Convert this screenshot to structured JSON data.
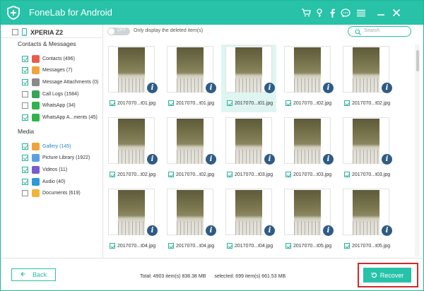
{
  "app": {
    "title": "FoneLab for Android",
    "accent_color": "#27c2a7"
  },
  "titlebar_icons": [
    "cart-icon",
    "key-icon",
    "facebook-icon",
    "chat-icon",
    "menu-icon",
    "minimize-icon",
    "close-icon"
  ],
  "device": {
    "name": "XPERIA Z2",
    "checked": false,
    "icon": "phone-icon"
  },
  "sidebar": {
    "sections": [
      {
        "title": "Contacts & Messages",
        "items": [
          {
            "label": "Contacts (496)",
            "checked": true,
            "icon": "contacts-icon",
            "color": "#e85c4a"
          },
          {
            "label": "Messages (7)",
            "checked": true,
            "icon": "messages-icon",
            "color": "#f2a23a"
          },
          {
            "label": "Message Attachments (0)",
            "checked": true,
            "icon": "attachment-icon",
            "color": "#8a8a8a"
          },
          {
            "label": "Call Logs (1584)",
            "checked": false,
            "icon": "call-log-icon",
            "color": "#3aa35a"
          },
          {
            "label": "WhatsApp (34)",
            "checked": false,
            "icon": "whatsapp-icon",
            "color": "#2fb34a"
          },
          {
            "label": "WhatsApp A...ments (45)",
            "checked": true,
            "icon": "whatsapp-attachment-icon",
            "color": "#2fb34a"
          }
        ]
      },
      {
        "title": "Media",
        "items": [
          {
            "label": "Gallery (145)",
            "checked": true,
            "icon": "gallery-icon",
            "color": "#f0a33b",
            "active": true
          },
          {
            "label": "Picture Library (1922)",
            "checked": true,
            "icon": "picture-library-icon",
            "color": "#5aa0e0"
          },
          {
            "label": "Videos (11)",
            "checked": true,
            "icon": "videos-icon",
            "color": "#7a5ad0"
          },
          {
            "label": "Audio (40)",
            "checked": true,
            "icon": "audio-icon",
            "color": "#2c9ad8"
          },
          {
            "label": "Documents (619)",
            "checked": false,
            "icon": "documents-icon",
            "color": "#f2b53a"
          }
        ]
      }
    ]
  },
  "filter": {
    "toggle_label": "OFF",
    "toggle_on": false,
    "text": "Only display the deleted item(s)"
  },
  "search": {
    "placeholder": "Search"
  },
  "grid": {
    "items": [
      {
        "label": "2017070...t01.jpg",
        "checked": true,
        "selected": false
      },
      {
        "label": "2017070...t01.jpg",
        "checked": true,
        "selected": false
      },
      {
        "label": "2017070...t01.jpg",
        "checked": true,
        "selected": true
      },
      {
        "label": "2017070...t02.jpg",
        "checked": true,
        "selected": false
      },
      {
        "label": "2017070...t02.jpg",
        "checked": true,
        "selected": false
      },
      {
        "label": "2017070...t02.jpg",
        "checked": true,
        "selected": false
      },
      {
        "label": "2017070...t02.jpg",
        "checked": true,
        "selected": false
      },
      {
        "label": "2017070...t03.jpg",
        "checked": true,
        "selected": false
      },
      {
        "label": "2017070...t03.jpg",
        "checked": true,
        "selected": false
      },
      {
        "label": "2017070...t03.jpg",
        "checked": true,
        "selected": false
      },
      {
        "label": "2017070...t04.jpg",
        "checked": true,
        "selected": false
      },
      {
        "label": "2017070...t04.jpg",
        "checked": true,
        "selected": false
      },
      {
        "label": "2017070...t04.jpg",
        "checked": true,
        "selected": false
      },
      {
        "label": "2017070...t05.jpg",
        "checked": true,
        "selected": false
      },
      {
        "label": "2017070...t05.jpg",
        "checked": true,
        "selected": false
      }
    ],
    "info_glyph": "i"
  },
  "footer": {
    "back_label": "Back",
    "total": "Total: 4903 item(s) 838.38 MB",
    "selected": "selected: 699 item(s) 661.53 MB",
    "recover_label": "Recover",
    "recover_highlight_color": "#d12a2a"
  }
}
